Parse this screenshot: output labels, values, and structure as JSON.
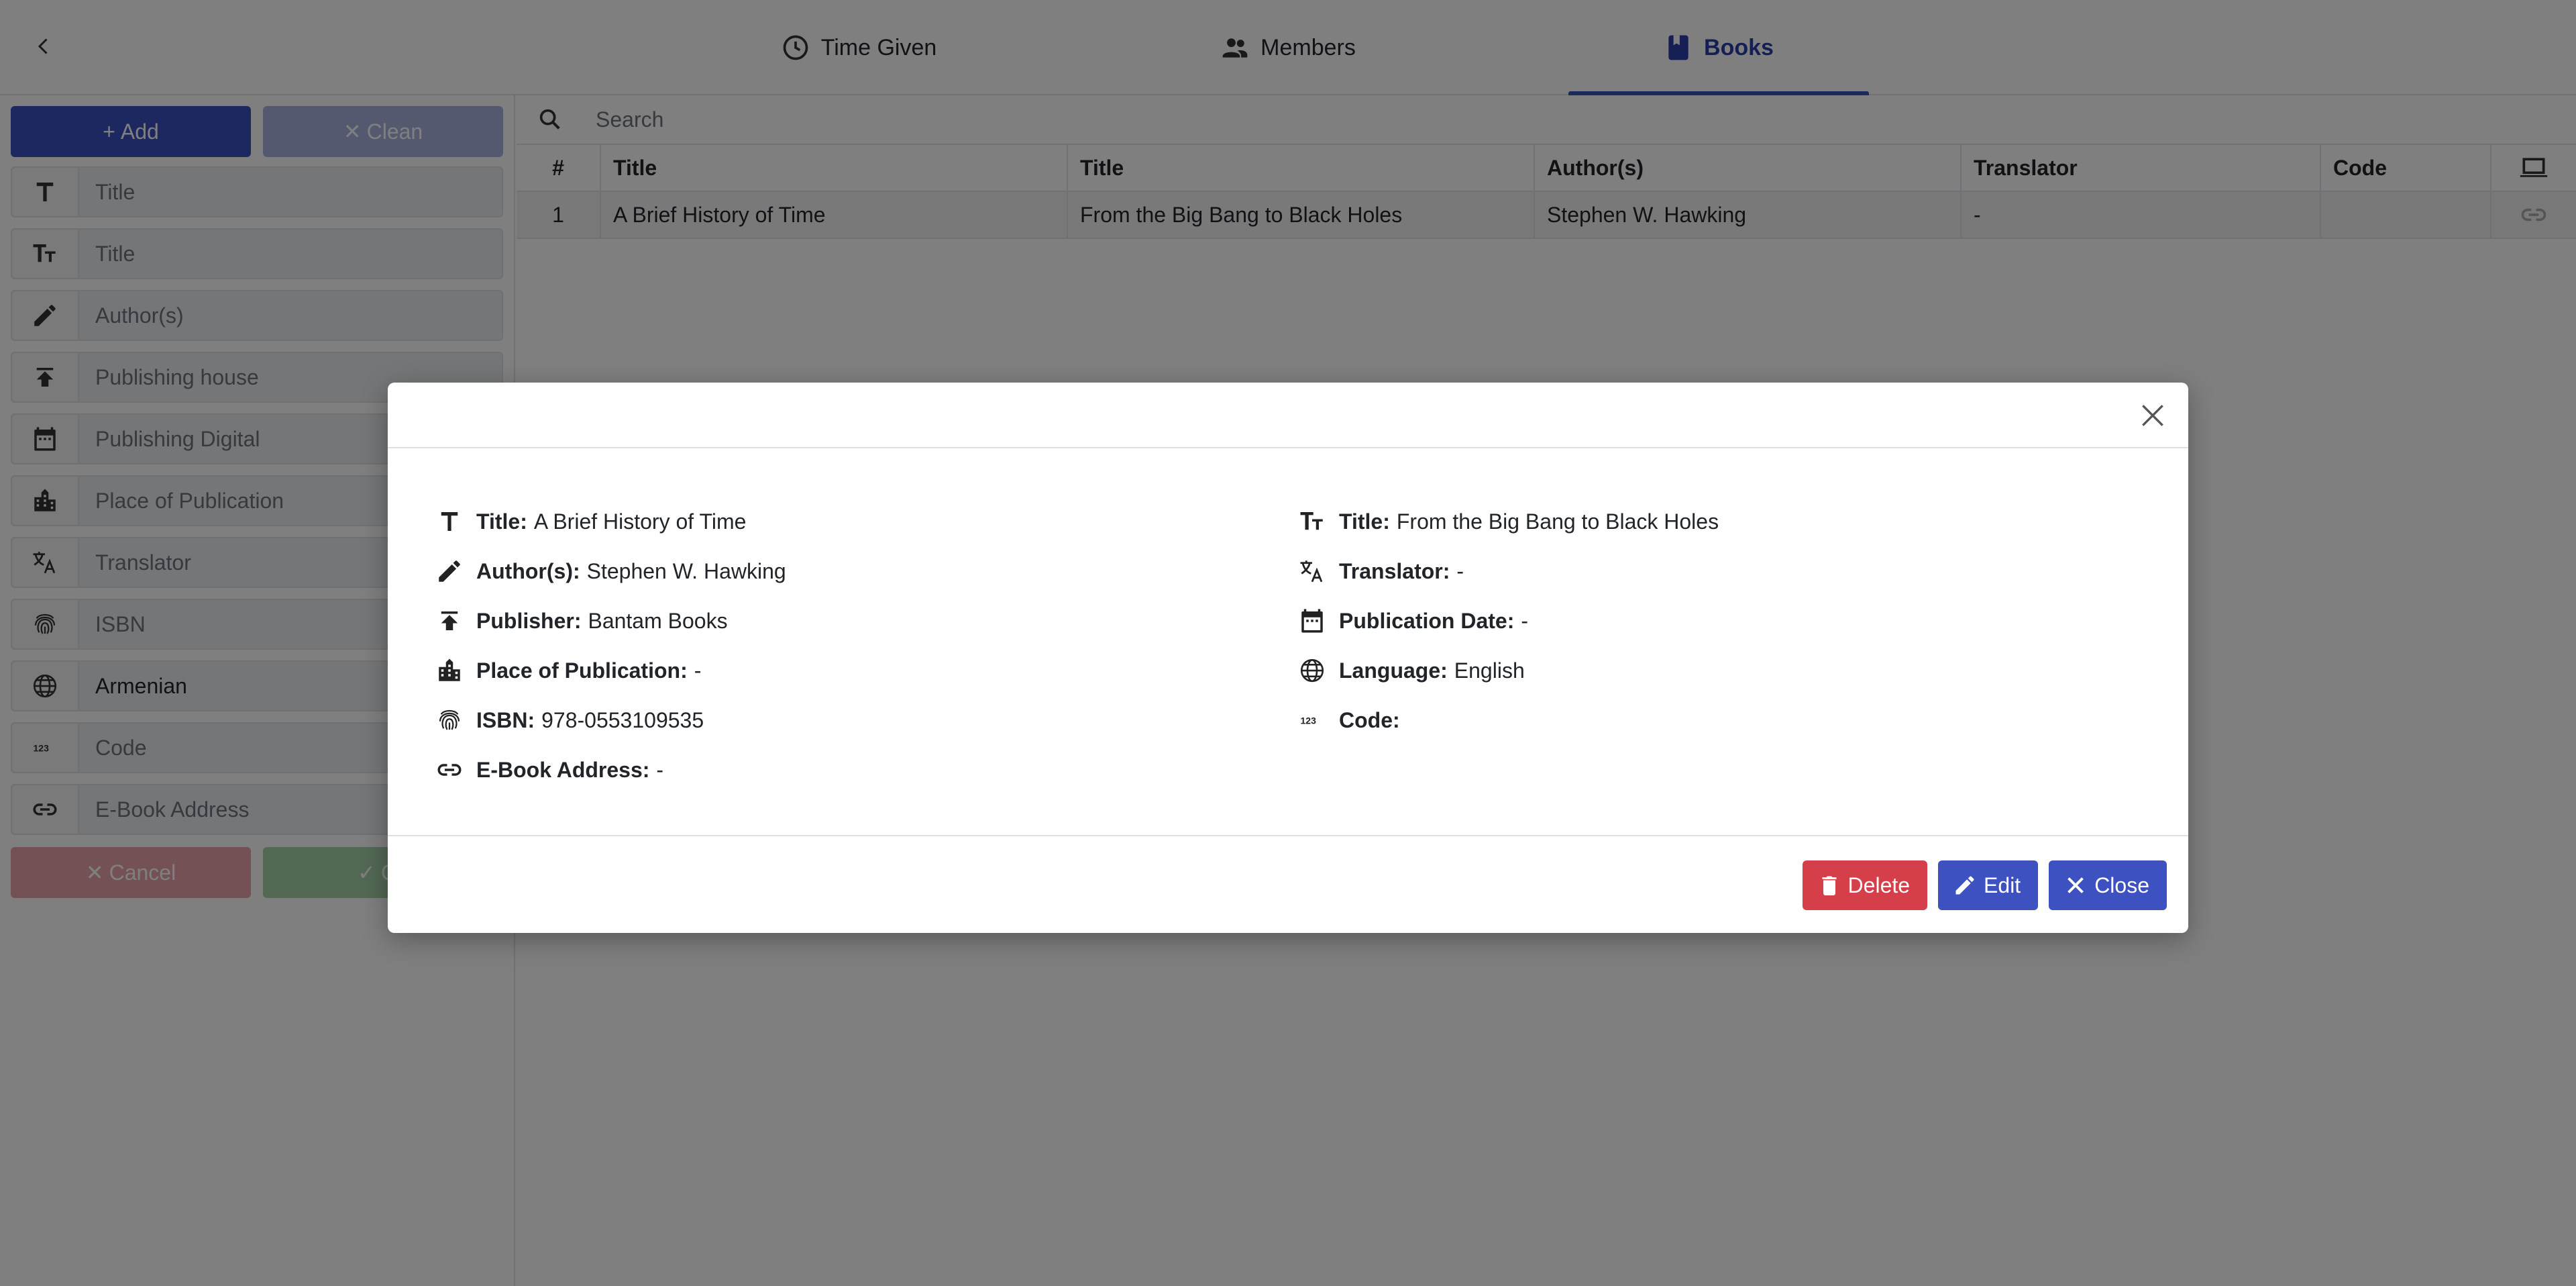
{
  "tabs": [
    {
      "label": "Time Given",
      "icon": "clock-icon"
    },
    {
      "label": "Members",
      "icon": "group-icon"
    },
    {
      "label": "Books",
      "icon": "book-icon",
      "active": true
    }
  ],
  "left_panel": {
    "add_label": "Add",
    "clean_label": "Clean",
    "cancel_label": "Cancel",
    "confirm_label": "Co",
    "fields": [
      {
        "icon": "title-icon",
        "placeholder": "Title"
      },
      {
        "icon": "subtitle-icon",
        "placeholder": "Title"
      },
      {
        "icon": "pencil-icon",
        "placeholder": "Author(s)"
      },
      {
        "icon": "publish-icon",
        "placeholder": "Publishing house"
      },
      {
        "icon": "calendar-icon",
        "placeholder": "Publishing Digital"
      },
      {
        "icon": "city-icon",
        "placeholder": "Place of Publication"
      },
      {
        "icon": "translate-icon",
        "placeholder": "Translator"
      },
      {
        "icon": "fingerprint-icon",
        "placeholder": "ISBN"
      },
      {
        "icon": "globe-icon",
        "value": "Armenian"
      },
      {
        "icon": "numbers-icon",
        "placeholder": "Code"
      },
      {
        "icon": "link-icon",
        "placeholder": "E-Book Address"
      }
    ]
  },
  "search": {
    "placeholder": "Search"
  },
  "table": {
    "headers": [
      "#",
      "Title",
      "Title",
      "Author(s)",
      "Translator",
      "Code"
    ],
    "rows": [
      {
        "num": "1",
        "title": "A Brief History of Time",
        "subtitle": "From the Big Bang to Black Holes",
        "authors": "Stephen W. Hawking",
        "translator": "-",
        "code": ""
      }
    ]
  },
  "modal": {
    "left": [
      {
        "icon": "title-icon",
        "label": "Title:",
        "value": "A Brief History of Time"
      },
      {
        "icon": "pencil-icon",
        "label": "Author(s):",
        "value": "Stephen W. Hawking"
      },
      {
        "icon": "publish-icon",
        "label": "Publisher:",
        "value": "Bantam Books"
      },
      {
        "icon": "city-icon",
        "label": "Place of Publication:",
        "value": "-"
      },
      {
        "icon": "fingerprint-icon",
        "label": "ISBN:",
        "value": "978-0553109535"
      },
      {
        "icon": "link-icon",
        "label": "E-Book Address:",
        "value": "-"
      }
    ],
    "right": [
      {
        "icon": "subtitle-icon",
        "label": "Title:",
        "value": "From the Big Bang to Black Holes"
      },
      {
        "icon": "translate-icon",
        "label": "Translator:",
        "value": "-"
      },
      {
        "icon": "calendar-icon",
        "label": "Publication Date:",
        "value": "-"
      },
      {
        "icon": "globe-icon",
        "label": "Language:",
        "value": "English"
      },
      {
        "icon": "numbers-icon",
        "label": "Code:",
        "value": ""
      }
    ],
    "delete_label": "Delete",
    "edit_label": "Edit",
    "close_label": "Close"
  },
  "colors": {
    "primary": "#3d51c1",
    "danger": "#d43f4a",
    "success": "#4caf50",
    "active_tab_text": "#2b3ea6"
  }
}
